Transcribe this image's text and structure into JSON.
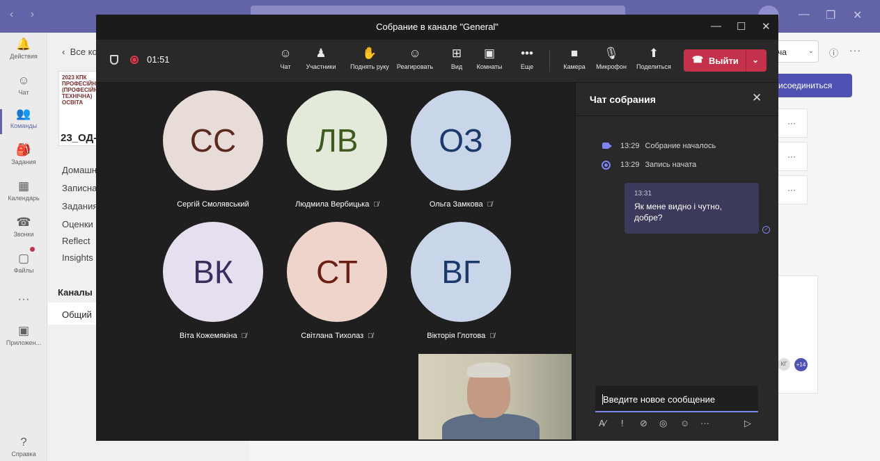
{
  "app": {
    "nav_arrows": "‹  ›",
    "win_controls": [
      "—",
      "❐",
      "✕"
    ]
  },
  "rail": {
    "items": [
      {
        "label": "Действия",
        "icon": "bell-icon",
        "glyph": "🔔"
      },
      {
        "label": "Чат",
        "icon": "chat-icon",
        "glyph": "☺"
      },
      {
        "label": "Команды",
        "icon": "teams-icon",
        "glyph": "👥"
      },
      {
        "label": "Задания",
        "icon": "backpack-icon",
        "glyph": "🎒"
      },
      {
        "label": "Календарь",
        "icon": "calendar-icon",
        "glyph": "▦"
      },
      {
        "label": "Звонки",
        "icon": "phone-icon",
        "glyph": "☎"
      },
      {
        "label": "Файлы",
        "icon": "file-icon",
        "glyph": "▢"
      },
      {
        "label": "",
        "icon": "more-icon",
        "glyph": "···"
      },
      {
        "label": "Приложен...",
        "icon": "apps-icon",
        "glyph": "▣"
      },
      {
        "label": "Справка",
        "icon": "help-icon",
        "glyph": "?"
      }
    ]
  },
  "teams_pane": {
    "back_label": "Все ко",
    "logo_text": "2023 КПК ПРОФЕСІЙНА (ПРОФЕСІЙНО-ТЕХНІЧНА) ОСВІТА",
    "team_name": "23_ОД-",
    "links": [
      "Домашн",
      "Записна",
      "Задания",
      "Оценки",
      "Reflect",
      "Insights"
    ],
    "channels_header": "Каналы",
    "channel_general": "Общий"
  },
  "right_bg": {
    "combo_value": "ча",
    "join_label": "исоединиться",
    "more_label": "···",
    "avatar_kg": "КГ",
    "avatar_plus": "+14"
  },
  "meeting": {
    "title": "Собрание в канале \"General\"",
    "timer": "01:51",
    "toolbar": [
      {
        "label": "Чат",
        "glyph": "☺",
        "icon": "chat-icon"
      },
      {
        "label": "Участники",
        "glyph": "♟",
        "icon": "participants-icon"
      },
      {
        "label": "Поднять руку",
        "glyph": "✋",
        "icon": "raise-hand-icon"
      },
      {
        "label": "Реагировать",
        "glyph": "☺",
        "icon": "react-icon"
      },
      {
        "label": "Вид",
        "glyph": "⊞",
        "icon": "view-icon"
      },
      {
        "label": "Комнаты",
        "glyph": "▣",
        "icon": "rooms-icon"
      },
      {
        "label": "Еще",
        "glyph": "•••",
        "icon": "more-icon"
      },
      {
        "label": "Камера",
        "glyph": "■",
        "icon": "camera-icon"
      },
      {
        "label": "Микрофон",
        "glyph": "🎙",
        "icon": "mic-icon"
      },
      {
        "label": "Поделиться",
        "glyph": "⬆",
        "icon": "share-icon"
      }
    ],
    "leave_label": "Выйти",
    "participants": [
      {
        "initials": "СС",
        "name": "Сергій Смолявський",
        "muted": false,
        "bg": "#e8dcd8",
        "fg": "#5a2a1f"
      },
      {
        "initials": "ЛВ",
        "name": "Людмила Вербицька",
        "muted": true,
        "bg": "#e3ead9",
        "fg": "#3f5a20"
      },
      {
        "initials": "ОЗ",
        "name": "Ольга Замкова",
        "muted": true,
        "bg": "#c9d5e8",
        "fg": "#1b3a6b"
      },
      {
        "initials": "ВК",
        "name": "Віта Кожемякіна",
        "muted": true,
        "bg": "#e5dff0",
        "fg": "#3b2d5e"
      },
      {
        "initials": "СТ",
        "name": "Світлана Тихолаз",
        "muted": true,
        "bg": "#efd4cc",
        "fg": "#6b1f14"
      },
      {
        "initials": "ВГ",
        "name": "Вікторія Глотова",
        "muted": true,
        "bg": "#c9d5e8",
        "fg": "#1b3a6b"
      }
    ]
  },
  "chat": {
    "title": "Чат собрания",
    "events": [
      {
        "time": "13:29",
        "text": "Собрание началось"
      },
      {
        "time": "13:29",
        "text": "Запись начата"
      }
    ],
    "message": {
      "time": "13:31",
      "text": "Як мене видно і чутно, добре?"
    },
    "input_placeholder": "Введите новое сообщение",
    "tools": [
      "A⁄",
      "!",
      "⊘",
      "◎",
      "☺",
      "···",
      "▷"
    ]
  },
  "colors": {
    "brand": "#6264a7",
    "leave": "#c4314b",
    "accent": "#7f85f5"
  }
}
